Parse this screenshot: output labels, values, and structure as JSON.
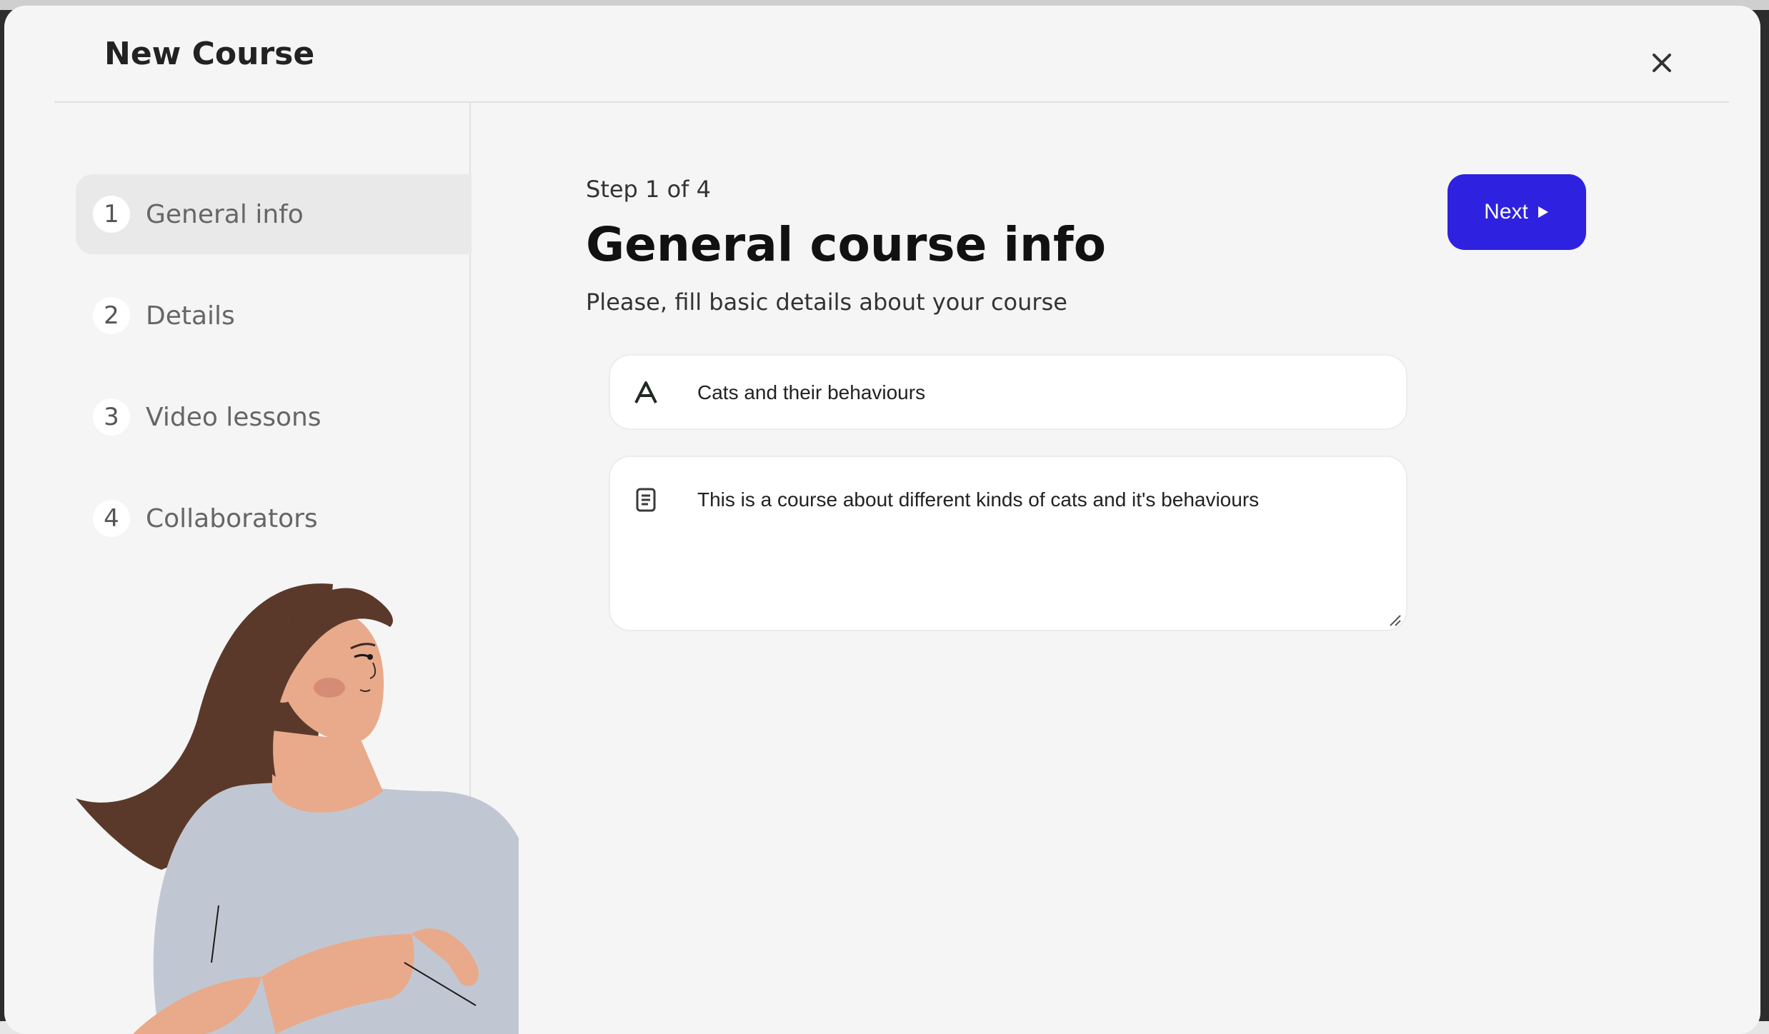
{
  "modal": {
    "title": "New Course",
    "close_icon": "close-icon"
  },
  "steps": [
    {
      "number": "1",
      "label": "General info",
      "active": true
    },
    {
      "number": "2",
      "label": "Details",
      "active": false
    },
    {
      "number": "3",
      "label": "Video lessons",
      "active": false
    },
    {
      "number": "4",
      "label": "Collaborators",
      "active": false
    }
  ],
  "main": {
    "step_counter": "Step 1 of 4",
    "title": "General course info",
    "subtitle": "Please, fill basic details about your course",
    "next_label": "Next",
    "next_icon": "play-icon"
  },
  "form": {
    "title_field": {
      "icon": "text-icon",
      "value": "Cats and their behaviours"
    },
    "description_field": {
      "icon": "document-icon",
      "value": "This is a course about different kinds of cats and it's behaviours"
    }
  },
  "colors": {
    "accent": "#2e22e0",
    "modal_bg": "#f5f5f5",
    "active_step_bg": "#e9e9e9"
  }
}
